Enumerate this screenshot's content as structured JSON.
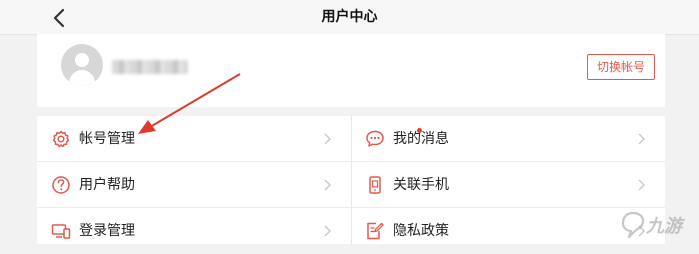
{
  "header": {
    "title": "用户中心"
  },
  "profile": {
    "switch_account_label": "切换帐号"
  },
  "menu": {
    "items": [
      {
        "label": "帐号管理",
        "icon": "gear-icon"
      },
      {
        "label": "我的消息",
        "icon": "chat-icon",
        "badge": "red-dot"
      },
      {
        "label": "用户帮助",
        "icon": "question-icon"
      },
      {
        "label": "关联手机",
        "icon": "phone-icon"
      },
      {
        "label": "登录管理",
        "icon": "devices-icon"
      },
      {
        "label": "隐私政策",
        "icon": "document-edit-icon"
      }
    ]
  },
  "watermark": {
    "text": "九游"
  },
  "colors": {
    "accent": "#e05a4e",
    "badge": "#e23b2e",
    "background": "#f2f2f2"
  }
}
